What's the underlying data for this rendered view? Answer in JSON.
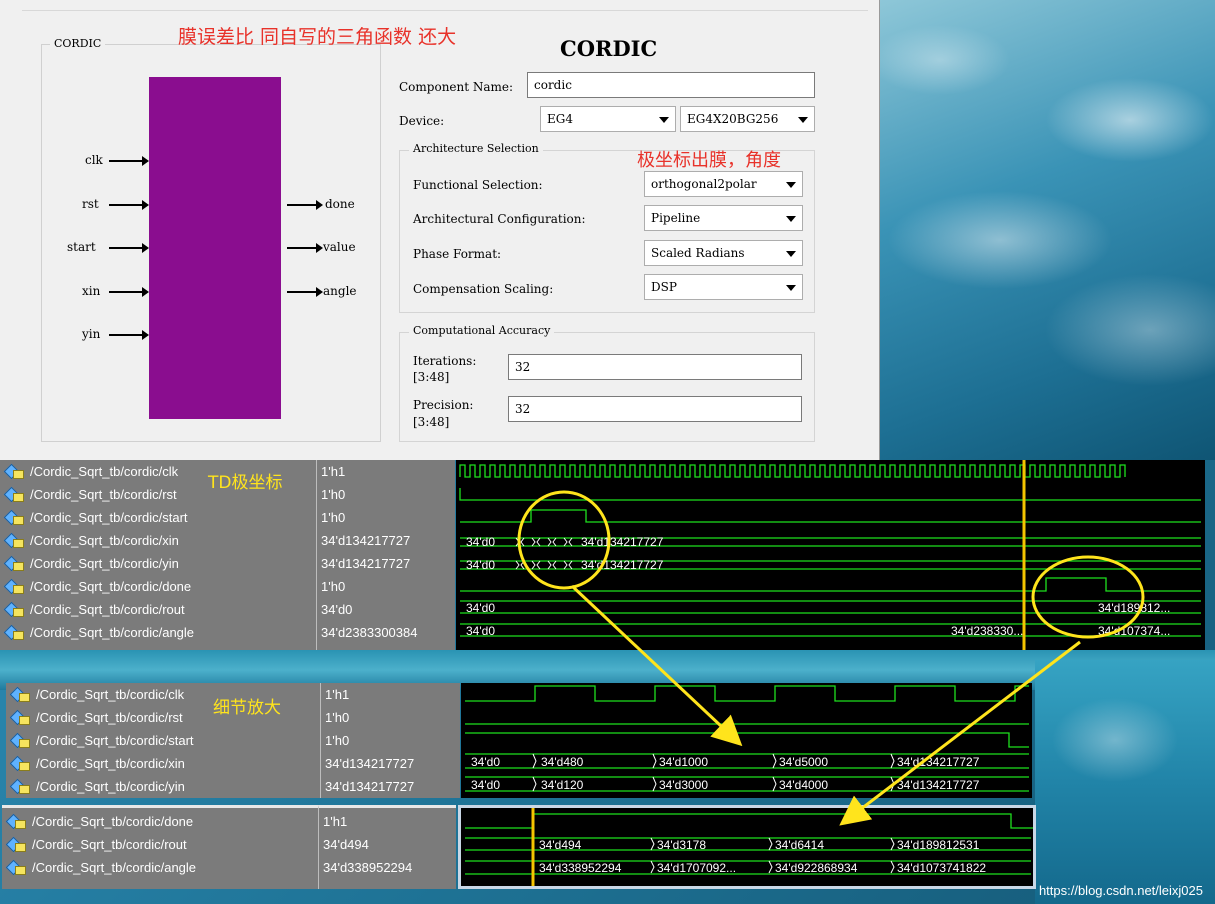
{
  "dialog": {
    "symbol_group_label": "CORDIC",
    "annotation_top": "膜误差比 同自写的三角函数 还大",
    "title": "CORDIC",
    "inputs": [
      "clk",
      "rst",
      "start",
      "xin",
      "yin"
    ],
    "outputs": [
      "done",
      "value",
      "angle"
    ],
    "component_name_label": "Component Name:",
    "component_name_value": "cordic",
    "device_label": "Device:",
    "device_family": "EG4",
    "device_part": "EG4X20BG256",
    "arch_group_label": "Architecture Selection",
    "annotation_arch": "极坐标出膜，角度",
    "functional_selection_label": "Functional Selection:",
    "functional_selection_value": "orthogonal2polar",
    "arch_config_label": "Architectural Configuration:",
    "arch_config_value": "Pipeline",
    "phase_format_label": "Phase Format:",
    "phase_format_value": "Scaled Radians",
    "comp_scaling_label": "Compensation Scaling:",
    "comp_scaling_value": "DSP",
    "accuracy_group_label": "Computational Accuracy",
    "iterations_label": "Iterations:",
    "iterations_range": "[3:48]",
    "iterations_value": "32",
    "precision_label": "Precision:",
    "precision_range": "[3:48]",
    "precision_value": "32"
  },
  "wave1": {
    "annotation": "TD极坐标",
    "signals": [
      {
        "name": "/Cordic_Sqrt_tb/cordic/clk",
        "value": "1'h1"
      },
      {
        "name": "/Cordic_Sqrt_tb/cordic/rst",
        "value": "1'h0"
      },
      {
        "name": "/Cordic_Sqrt_tb/cordic/start",
        "value": "1'h0"
      },
      {
        "name": "/Cordic_Sqrt_tb/cordic/xin",
        "value": "34'd134217727"
      },
      {
        "name": "/Cordic_Sqrt_tb/cordic/yin",
        "value": "34'd134217727"
      },
      {
        "name": "/Cordic_Sqrt_tb/cordic/done",
        "value": "1'h0"
      },
      {
        "name": "/Cordic_Sqrt_tb/cordic/rout",
        "value": "34'd0"
      },
      {
        "name": "/Cordic_Sqrt_tb/cordic/angle",
        "value": "34'd2383300384"
      }
    ],
    "bus_labels": {
      "xin_a": "34'd0",
      "xin_b": "34'd134217727",
      "yin_a": "34'd0",
      "yin_b": "34'd134217727",
      "rout_a": "34'd0",
      "rout_b": "34'd189812...",
      "angle_a": "34'd0",
      "angle_b": "34'd238330...",
      "angle_c": "34'd107374..."
    }
  },
  "wave2": {
    "annotation": "细节放大",
    "signals": [
      {
        "name": "/Cordic_Sqrt_tb/cordic/clk",
        "value": "1'h1"
      },
      {
        "name": "/Cordic_Sqrt_tb/cordic/rst",
        "value": "1'h0"
      },
      {
        "name": "/Cordic_Sqrt_tb/cordic/start",
        "value": "1'h0"
      },
      {
        "name": "/Cordic_Sqrt_tb/cordic/xin",
        "value": "34'd134217727"
      },
      {
        "name": "/Cordic_Sqrt_tb/cordic/yin",
        "value": "34'd134217727"
      }
    ],
    "xin_vals": [
      "34'd0",
      "34'd480",
      "34'd1000",
      "34'd5000",
      "34'd134217727"
    ],
    "yin_vals": [
      "34'd0",
      "34'd120",
      "34'd3000",
      "34'd4000",
      "34'd134217727"
    ]
  },
  "wave3": {
    "signals": [
      {
        "name": "/Cordic_Sqrt_tb/cordic/done",
        "value": "1'h1"
      },
      {
        "name": "/Cordic_Sqrt_tb/cordic/rout",
        "value": "34'd494"
      },
      {
        "name": "/Cordic_Sqrt_tb/cordic/angle",
        "value": "34'd338952294"
      }
    ],
    "rout_vals": [
      "34'd494",
      "34'd3178",
      "34'd6414",
      "34'd189812531"
    ],
    "angle_vals": [
      "34'd338952294",
      "34'd1707092...",
      "34'd922868934",
      "34'd1073741822"
    ]
  },
  "watermark": "https://blog.csdn.net/leixj025"
}
